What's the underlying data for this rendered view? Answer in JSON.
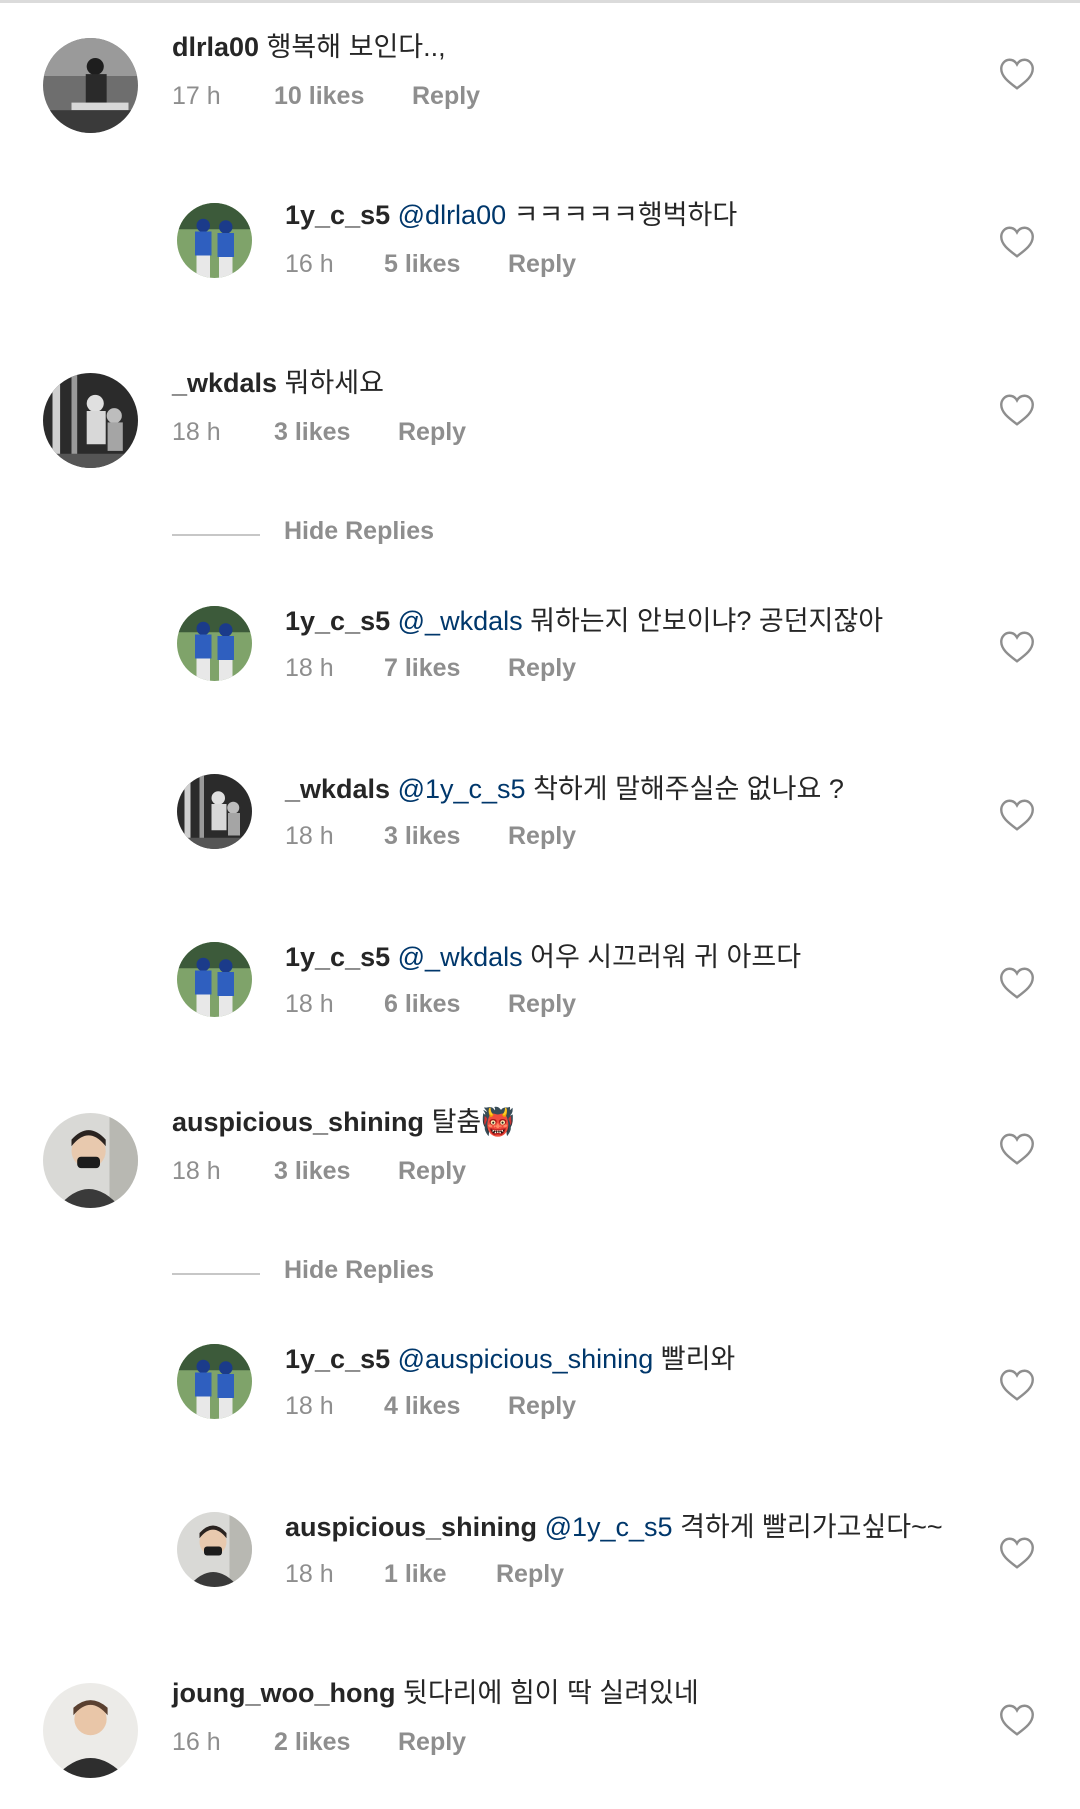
{
  "comments": [
    {
      "username": "dlrla00",
      "mention": "",
      "text": "행복해 보인다..,",
      "time": "17 h",
      "likes": "10 likes",
      "reply": "Reply",
      "avatar": "baseball-player-bw",
      "is_reply": false
    },
    {
      "username": "1y_c_s5",
      "mention": "@dlrla00",
      "text": "ㅋㅋㅋㅋㅋ행벅하다",
      "time": "16 h",
      "likes": "5 likes",
      "reply": "Reply",
      "avatar": "two-players-blue",
      "is_reply": true
    },
    {
      "username": "_wkdals",
      "mention": "",
      "text": "뭐하세요",
      "time": "18 h",
      "likes": "3 likes",
      "reply": "Reply",
      "avatar": "dugout-bw",
      "is_reply": false
    },
    {
      "username": "1y_c_s5",
      "mention": "@_wkdals",
      "text": "뭐하는지 안보이냐? 공던지잖아",
      "time": "18 h",
      "likes": "7 likes",
      "reply": "Reply",
      "avatar": "two-players-blue",
      "is_reply": true
    },
    {
      "username": "_wkdals",
      "mention": "@1y_c_s5",
      "text": "착하게 말해주실순 없나요 ?",
      "time": "18 h",
      "likes": "3 likes",
      "reply": "Reply",
      "avatar": "dugout-bw",
      "is_reply": true
    },
    {
      "username": "1y_c_s5",
      "mention": "@_wkdals",
      "text": "어우 시끄러워 귀 아프다",
      "time": "18 h",
      "likes": "6 likes",
      "reply": "Reply",
      "avatar": "two-players-blue",
      "is_reply": true
    },
    {
      "username": "auspicious_shining",
      "mention": "",
      "text": "탈춤👹",
      "time": "18 h",
      "likes": "3 likes",
      "reply": "Reply",
      "avatar": "person-mask",
      "is_reply": false
    },
    {
      "username": "1y_c_s5",
      "mention": "@auspicious_shining",
      "text": "빨리와",
      "time": "18 h",
      "likes": "4 likes",
      "reply": "Reply",
      "avatar": "two-players-blue",
      "is_reply": true
    },
    {
      "username": "auspicious_shining",
      "mention": "@1y_c_s5",
      "text": "격하게 빨리가고싶다~~",
      "time": "18 h",
      "likes": "1 like",
      "reply": "Reply",
      "avatar": "person-mask",
      "is_reply": true
    },
    {
      "username": "joung_woo_hong",
      "mention": "",
      "text": "뒷다리에 힘이 딱 실려있네",
      "time": "16 h",
      "likes": "2 likes",
      "reply": "Reply",
      "avatar": "person-portrait",
      "is_reply": false
    }
  ],
  "hide_replies_label": "Hide Replies",
  "colors": {
    "mention": "#00376b",
    "meta": "#8e8e8e",
    "text": "#262626"
  }
}
